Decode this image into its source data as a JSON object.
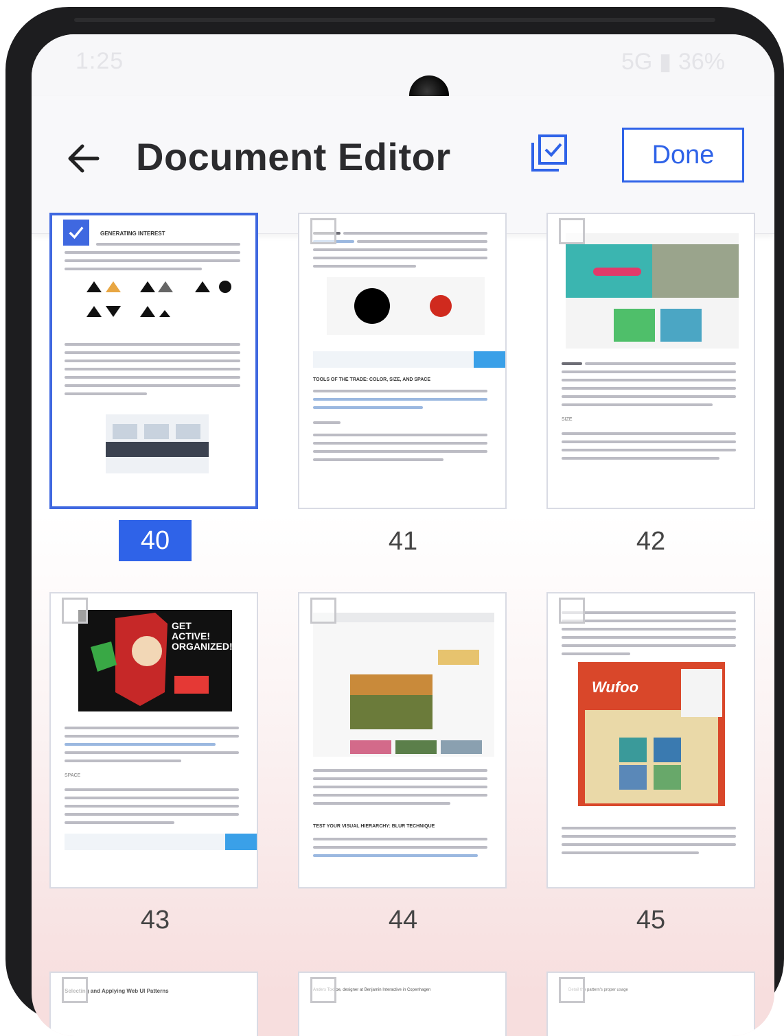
{
  "status_bar": {
    "time": "1:25",
    "network": "5G",
    "battery": "36%"
  },
  "app_bar": {
    "title": "Document Editor",
    "done_label": "Done"
  },
  "colors": {
    "accent": "#2f63e8"
  },
  "icons": {
    "back": "arrow-left-icon",
    "select_all": "select-all-icon"
  },
  "pages": [
    {
      "number": "40",
      "selected": true,
      "heading": "GENERATING INTEREST"
    },
    {
      "number": "41",
      "selected": false,
      "heading": "TOOLS OF THE TRADE: COLOR, SIZE, AND SPACE"
    },
    {
      "number": "42",
      "selected": false,
      "heading": "SIZE"
    },
    {
      "number": "43",
      "selected": false,
      "heading": "SPACE",
      "poster_text": "GET ACTIVE! ORGANIZED!"
    },
    {
      "number": "44",
      "selected": false,
      "heading": "TEST YOUR VISUAL HIERARCHY: BLUR TECHNIQUE"
    },
    {
      "number": "45",
      "selected": false,
      "heading": "Wufoo"
    }
  ],
  "partial_row": [
    {
      "heading": "Selecting and Applying Web UI Patterns"
    },
    {
      "heading": "Anders Toxboe, designer at Benjamin Interactive in Copenhagen"
    },
    {
      "heading": "Detail the pattern's proper usage"
    }
  ]
}
